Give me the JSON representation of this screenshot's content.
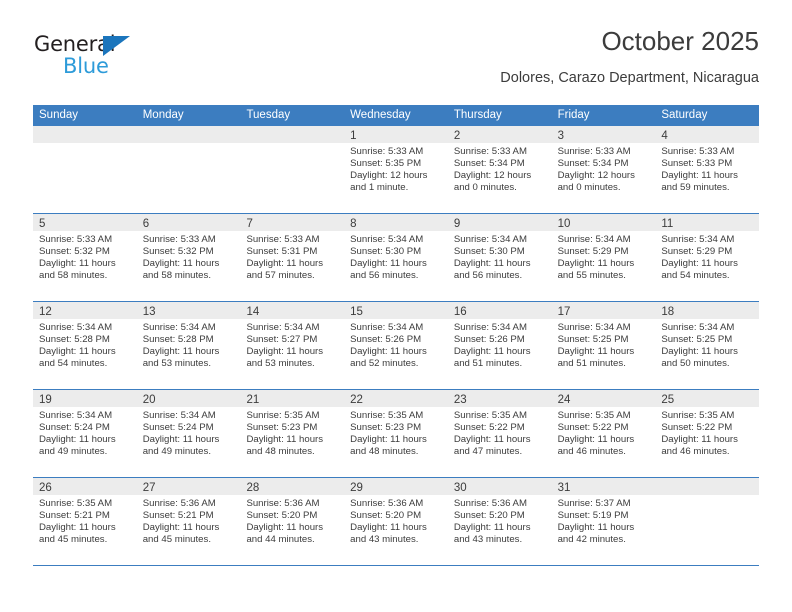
{
  "brand": {
    "name_part1": "General",
    "name_part2": "Blue",
    "accent_color": "#1b75bc",
    "accent_color_light": "#2d9bd9"
  },
  "header": {
    "title": "October 2025",
    "subtitle": "Dolores, Carazo Department, Nicaragua"
  },
  "calendar": {
    "header_color": "#3c7dc0",
    "daynum_band_color": "#ececec",
    "weekdays": [
      "Sunday",
      "Monday",
      "Tuesday",
      "Wednesday",
      "Thursday",
      "Friday",
      "Saturday"
    ],
    "labels": {
      "sunrise": "Sunrise:",
      "sunset": "Sunset:",
      "daylight": "Daylight:"
    },
    "weeks": [
      [
        {
          "day": ""
        },
        {
          "day": ""
        },
        {
          "day": ""
        },
        {
          "day": "1",
          "sunrise": "Sunrise: 5:33 AM",
          "sunset": "Sunset: 5:35 PM",
          "daylight_line1": "Daylight: 12 hours",
          "daylight_line2": "and 1 minute."
        },
        {
          "day": "2",
          "sunrise": "Sunrise: 5:33 AM",
          "sunset": "Sunset: 5:34 PM",
          "daylight_line1": "Daylight: 12 hours",
          "daylight_line2": "and 0 minutes."
        },
        {
          "day": "3",
          "sunrise": "Sunrise: 5:33 AM",
          "sunset": "Sunset: 5:34 PM",
          "daylight_line1": "Daylight: 12 hours",
          "daylight_line2": "and 0 minutes."
        },
        {
          "day": "4",
          "sunrise": "Sunrise: 5:33 AM",
          "sunset": "Sunset: 5:33 PM",
          "daylight_line1": "Daylight: 11 hours",
          "daylight_line2": "and 59 minutes."
        }
      ],
      [
        {
          "day": "5",
          "sunrise": "Sunrise: 5:33 AM",
          "sunset": "Sunset: 5:32 PM",
          "daylight_line1": "Daylight: 11 hours",
          "daylight_line2": "and 58 minutes."
        },
        {
          "day": "6",
          "sunrise": "Sunrise: 5:33 AM",
          "sunset": "Sunset: 5:32 PM",
          "daylight_line1": "Daylight: 11 hours",
          "daylight_line2": "and 58 minutes."
        },
        {
          "day": "7",
          "sunrise": "Sunrise: 5:33 AM",
          "sunset": "Sunset: 5:31 PM",
          "daylight_line1": "Daylight: 11 hours",
          "daylight_line2": "and 57 minutes."
        },
        {
          "day": "8",
          "sunrise": "Sunrise: 5:34 AM",
          "sunset": "Sunset: 5:30 PM",
          "daylight_line1": "Daylight: 11 hours",
          "daylight_line2": "and 56 minutes."
        },
        {
          "day": "9",
          "sunrise": "Sunrise: 5:34 AM",
          "sunset": "Sunset: 5:30 PM",
          "daylight_line1": "Daylight: 11 hours",
          "daylight_line2": "and 56 minutes."
        },
        {
          "day": "10",
          "sunrise": "Sunrise: 5:34 AM",
          "sunset": "Sunset: 5:29 PM",
          "daylight_line1": "Daylight: 11 hours",
          "daylight_line2": "and 55 minutes."
        },
        {
          "day": "11",
          "sunrise": "Sunrise: 5:34 AM",
          "sunset": "Sunset: 5:29 PM",
          "daylight_line1": "Daylight: 11 hours",
          "daylight_line2": "and 54 minutes."
        }
      ],
      [
        {
          "day": "12",
          "sunrise": "Sunrise: 5:34 AM",
          "sunset": "Sunset: 5:28 PM",
          "daylight_line1": "Daylight: 11 hours",
          "daylight_line2": "and 54 minutes."
        },
        {
          "day": "13",
          "sunrise": "Sunrise: 5:34 AM",
          "sunset": "Sunset: 5:28 PM",
          "daylight_line1": "Daylight: 11 hours",
          "daylight_line2": "and 53 minutes."
        },
        {
          "day": "14",
          "sunrise": "Sunrise: 5:34 AM",
          "sunset": "Sunset: 5:27 PM",
          "daylight_line1": "Daylight: 11 hours",
          "daylight_line2": "and 53 minutes."
        },
        {
          "day": "15",
          "sunrise": "Sunrise: 5:34 AM",
          "sunset": "Sunset: 5:26 PM",
          "daylight_line1": "Daylight: 11 hours",
          "daylight_line2": "and 52 minutes."
        },
        {
          "day": "16",
          "sunrise": "Sunrise: 5:34 AM",
          "sunset": "Sunset: 5:26 PM",
          "daylight_line1": "Daylight: 11 hours",
          "daylight_line2": "and 51 minutes."
        },
        {
          "day": "17",
          "sunrise": "Sunrise: 5:34 AM",
          "sunset": "Sunset: 5:25 PM",
          "daylight_line1": "Daylight: 11 hours",
          "daylight_line2": "and 51 minutes."
        },
        {
          "day": "18",
          "sunrise": "Sunrise: 5:34 AM",
          "sunset": "Sunset: 5:25 PM",
          "daylight_line1": "Daylight: 11 hours",
          "daylight_line2": "and 50 minutes."
        }
      ],
      [
        {
          "day": "19",
          "sunrise": "Sunrise: 5:34 AM",
          "sunset": "Sunset: 5:24 PM",
          "daylight_line1": "Daylight: 11 hours",
          "daylight_line2": "and 49 minutes."
        },
        {
          "day": "20",
          "sunrise": "Sunrise: 5:34 AM",
          "sunset": "Sunset: 5:24 PM",
          "daylight_line1": "Daylight: 11 hours",
          "daylight_line2": "and 49 minutes."
        },
        {
          "day": "21",
          "sunrise": "Sunrise: 5:35 AM",
          "sunset": "Sunset: 5:23 PM",
          "daylight_line1": "Daylight: 11 hours",
          "daylight_line2": "and 48 minutes."
        },
        {
          "day": "22",
          "sunrise": "Sunrise: 5:35 AM",
          "sunset": "Sunset: 5:23 PM",
          "daylight_line1": "Daylight: 11 hours",
          "daylight_line2": "and 48 minutes."
        },
        {
          "day": "23",
          "sunrise": "Sunrise: 5:35 AM",
          "sunset": "Sunset: 5:22 PM",
          "daylight_line1": "Daylight: 11 hours",
          "daylight_line2": "and 47 minutes."
        },
        {
          "day": "24",
          "sunrise": "Sunrise: 5:35 AM",
          "sunset": "Sunset: 5:22 PM",
          "daylight_line1": "Daylight: 11 hours",
          "daylight_line2": "and 46 minutes."
        },
        {
          "day": "25",
          "sunrise": "Sunrise: 5:35 AM",
          "sunset": "Sunset: 5:22 PM",
          "daylight_line1": "Daylight: 11 hours",
          "daylight_line2": "and 46 minutes."
        }
      ],
      [
        {
          "day": "26",
          "sunrise": "Sunrise: 5:35 AM",
          "sunset": "Sunset: 5:21 PM",
          "daylight_line1": "Daylight: 11 hours",
          "daylight_line2": "and 45 minutes."
        },
        {
          "day": "27",
          "sunrise": "Sunrise: 5:36 AM",
          "sunset": "Sunset: 5:21 PM",
          "daylight_line1": "Daylight: 11 hours",
          "daylight_line2": "and 45 minutes."
        },
        {
          "day": "28",
          "sunrise": "Sunrise: 5:36 AM",
          "sunset": "Sunset: 5:20 PM",
          "daylight_line1": "Daylight: 11 hours",
          "daylight_line2": "and 44 minutes."
        },
        {
          "day": "29",
          "sunrise": "Sunrise: 5:36 AM",
          "sunset": "Sunset: 5:20 PM",
          "daylight_line1": "Daylight: 11 hours",
          "daylight_line2": "and 43 minutes."
        },
        {
          "day": "30",
          "sunrise": "Sunrise: 5:36 AM",
          "sunset": "Sunset: 5:20 PM",
          "daylight_line1": "Daylight: 11 hours",
          "daylight_line2": "and 43 minutes."
        },
        {
          "day": "31",
          "sunrise": "Sunrise: 5:37 AM",
          "sunset": "Sunset: 5:19 PM",
          "daylight_line1": "Daylight: 11 hours",
          "daylight_line2": "and 42 minutes."
        },
        {
          "day": ""
        }
      ]
    ]
  }
}
